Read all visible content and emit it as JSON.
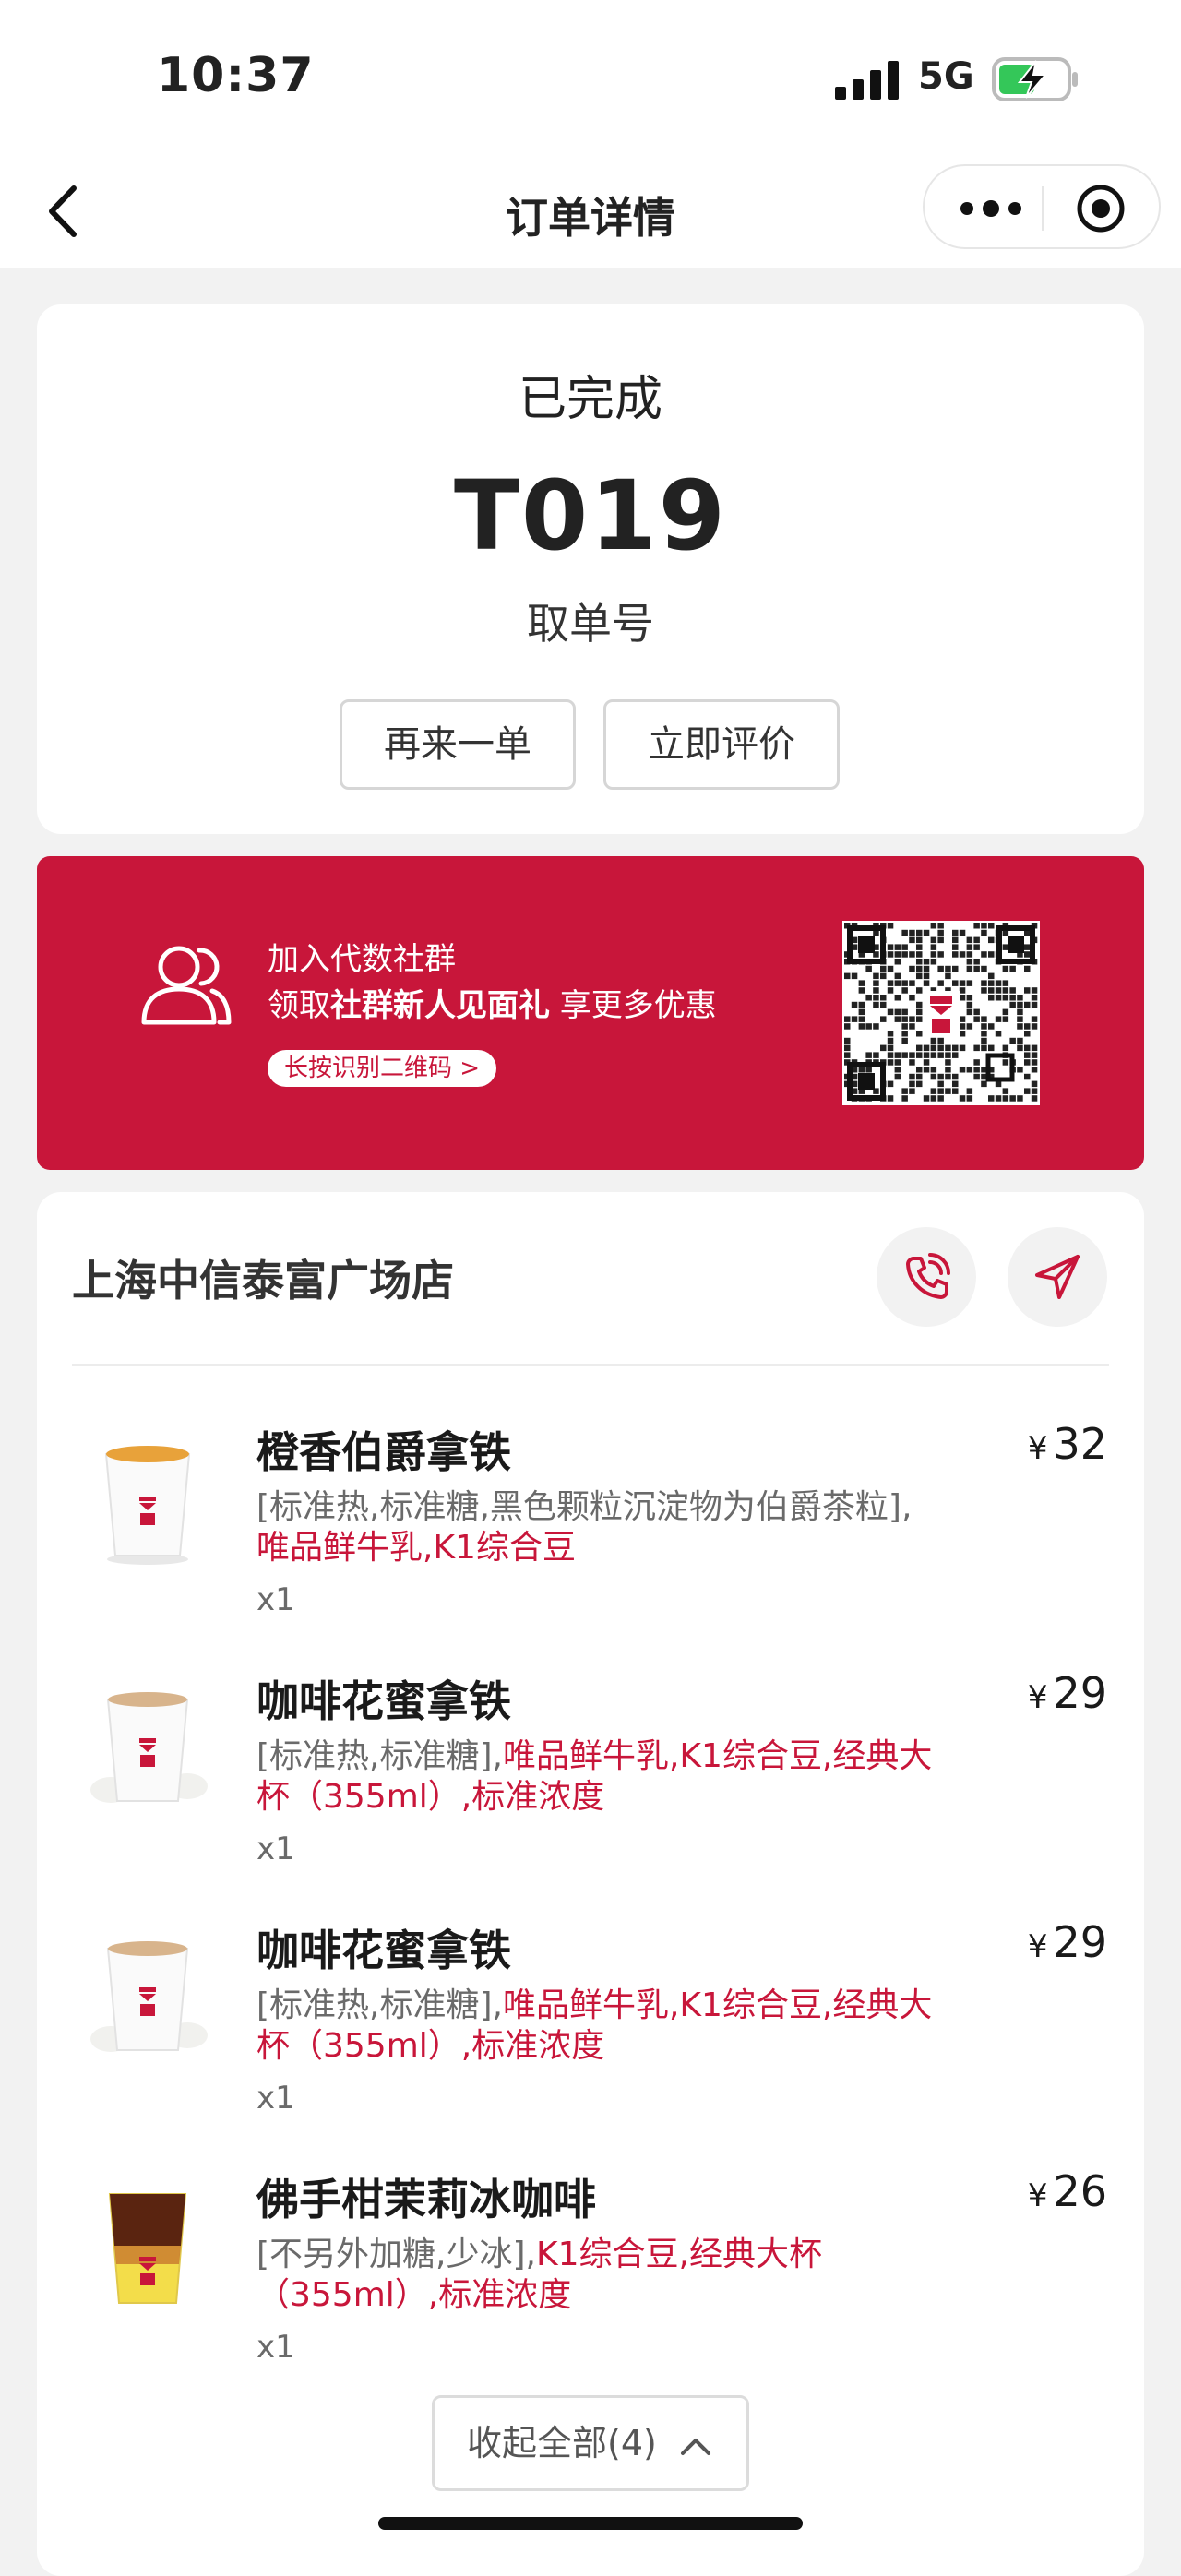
{
  "status_bar": {
    "time": "10:37",
    "network": "5G",
    "icons": [
      "signal-icon",
      "battery-charging-icon"
    ]
  },
  "navbar": {
    "title": "订单详情",
    "icons": [
      "back-icon",
      "more-icon",
      "close-target-icon"
    ]
  },
  "order_status": {
    "status": "已完成",
    "pickup_number": "T019",
    "pickup_label": "取单号",
    "reorder_label": "再来一单",
    "review_label": "立即评价"
  },
  "promo": {
    "line1": "加入代数社群",
    "line2_prefix": "领取",
    "line2_bold": "社群新人见面礼",
    "line2_suffix": " 享更多优惠",
    "pill": "长按识别二维码 >",
    "color": "#c8163a",
    "icons": [
      "group-icon",
      "qr-code"
    ]
  },
  "store": {
    "name": "上海中信泰富广场店",
    "icons": [
      "phone-icon",
      "navigation-icon"
    ]
  },
  "items": [
    {
      "name": "橙香伯爵拿铁",
      "currency": "¥",
      "price": "32",
      "spec_gray": "[标准热,标准糖,黑色颗粒沉淀物为伯爵茶粒],",
      "spec_red": "唯品鲜牛乳,K1综合豆",
      "qty": "x1"
    },
    {
      "name": "咖啡花蜜拿铁",
      "currency": "¥",
      "price": "29",
      "spec_gray": "[标准热,标准糖],",
      "spec_red": "唯品鲜牛乳,K1综合豆,经典大杯（355ml）,标准浓度",
      "qty": "x1"
    },
    {
      "name": "咖啡花蜜拿铁",
      "currency": "¥",
      "price": "29",
      "spec_gray": "[标准热,标准糖],",
      "spec_red": "唯品鲜牛乳,K1综合豆,经典大杯（355ml）,标准浓度",
      "qty": "x1"
    },
    {
      "name": "佛手柑茉莉冰咖啡",
      "currency": "¥",
      "price": "26",
      "spec_gray": "[不另外加糖,少冰],",
      "spec_red": "K1综合豆,经典大杯（355ml）,标准浓度",
      "qty": "x1"
    }
  ],
  "collapse_label": "收起全部(4)"
}
